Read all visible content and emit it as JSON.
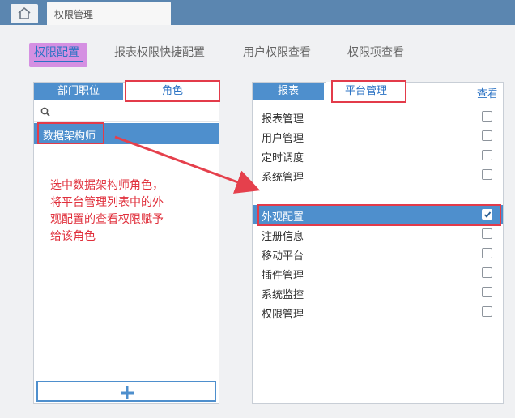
{
  "tabstrip": {
    "home_icon": "home-icon",
    "page_tab_title": "权限管理"
  },
  "nav": {
    "tabs": [
      "权限配置",
      "报表权限快捷配置",
      "用户权限查看",
      "权限项查看"
    ],
    "active": "权限配置"
  },
  "left_panel": {
    "tabs": [
      "部门职位",
      "角色"
    ],
    "active_tab": "角色",
    "search_icon": "search-icon",
    "roles": [
      "数据架构师"
    ],
    "add_icon": "plus-icon"
  },
  "right_panel": {
    "tabs": [
      "报表",
      "平台管理"
    ],
    "active_tab": "平台管理",
    "column_header": "查看",
    "items": [
      {
        "label": "报表管理",
        "checked": false
      },
      {
        "label": "用户管理",
        "checked": false
      },
      {
        "label": "定时调度",
        "checked": false
      },
      {
        "label": "系统管理",
        "checked": false
      },
      {
        "label": "外观配置",
        "checked": true
      },
      {
        "label": "注册信息",
        "checked": false
      },
      {
        "label": "移动平台",
        "checked": false
      },
      {
        "label": "插件管理",
        "checked": false
      },
      {
        "label": "系统监控",
        "checked": false
      },
      {
        "label": "权限管理",
        "checked": false
      }
    ],
    "selected_item": "外观配置"
  },
  "annotation": {
    "lines": [
      "选中数据架构师角色，",
      "将平台管理列表中的外",
      "观配置的查看权限赋予",
      "给该角色"
    ]
  },
  "colors": {
    "accent_blue": "#4e8fcd",
    "highlight_red": "#e33b4a",
    "nav_highlight": "#d590e2"
  }
}
